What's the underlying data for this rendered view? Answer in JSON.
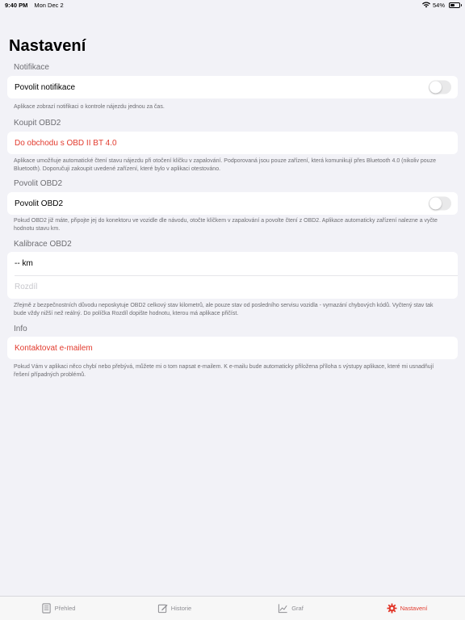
{
  "status_bar": {
    "time": "9:40 PM",
    "date": "Mon Dec 2",
    "battery": "54%",
    "battery_level": 0.54
  },
  "page_title": "Nastavení",
  "sections": {
    "notifications": {
      "header": "Notifikace",
      "toggle_label": "Povolit notifikace",
      "toggle_on": false,
      "footer": "Aplikace zobrazí notifikaci o kontrole nájezdu jednou za čas."
    },
    "buy": {
      "header": "Koupit OBD2",
      "link_label": "Do obchodu s OBD II BT 4.0",
      "footer": "Aplikace umožňuje automatické čtení stavu nájezdu při otočení klíčku v zapalování. Podporovaná jsou pouze zařízení, která komunikují přes Bluetooth 4.0 (nikoliv pouze Bluetooth). Doporučuji zakoupit uvedené zařízení, které bylo v aplikaci otestováno."
    },
    "obd2": {
      "header": "Povolit OBD2",
      "toggle_label": "Povolit OBD2",
      "toggle_on": false,
      "footer": "Pokud OBD2 již máte, připojte jej do konektoru ve vozidle dle návodu, otočte klíčkem v zapalování a povolte čtení z OBD2. Aplikace automaticky zařízení nalezne a vyčte hodnotu stavu km."
    },
    "calibration": {
      "header": "Kalibrace OBD2",
      "km_value": "-- km",
      "diff_placeholder": "Rozdíl",
      "footer": "Zřejmě z bezpečnostních důvodu neposkytuje OBD2 celkový stav kilometrů, ale pouze stav od posledního servisu vozidla - vymazání chybových kódů. Vyčtený stav tak bude vždy nižší než reálný. Do políčka Rozdíl dopište hodnotu, kterou má aplikace přičíst."
    },
    "info": {
      "header": "Info",
      "link_label": "Kontaktovat e-mailem",
      "footer": "Pokud Vám v aplikaci něco chybí nebo přebývá, můžete mi o tom napsat e-mailem. K e-mailu bude automaticky přiložena příloha s výstupy aplikace, které mi usnadňují řešení případných problémů."
    }
  },
  "tab_bar": {
    "tabs": [
      {
        "label": "Přehled",
        "icon": "document-icon"
      },
      {
        "label": "Historie",
        "icon": "edit-icon"
      },
      {
        "label": "Graf",
        "icon": "chart-icon"
      },
      {
        "label": "Nastavení",
        "icon": "gear-icon"
      }
    ],
    "active_index": 3
  },
  "colors": {
    "accent": "#e23b2e",
    "background": "#f2f2f7",
    "secondary_text": "#6d6d72"
  }
}
